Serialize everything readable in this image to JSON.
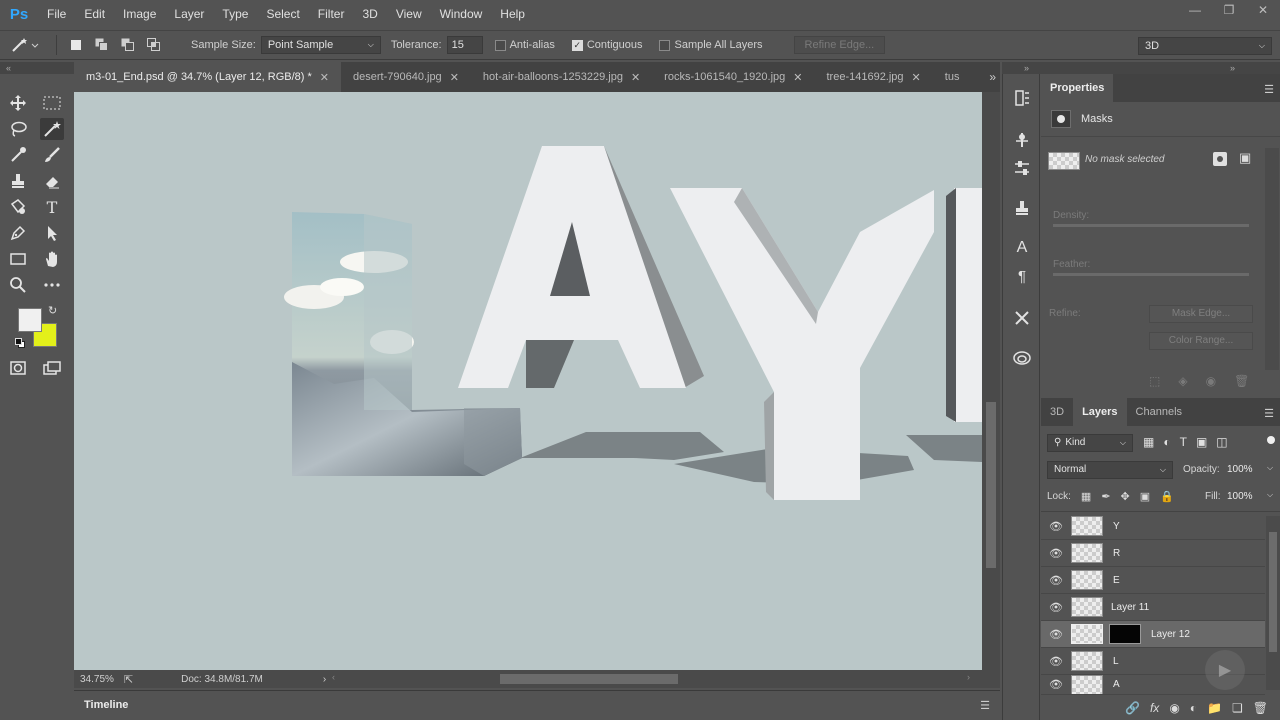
{
  "app": {
    "logo": "Ps"
  },
  "menu": [
    "File",
    "Edit",
    "Image",
    "Layer",
    "Type",
    "Select",
    "Filter",
    "3D",
    "View",
    "Window",
    "Help"
  ],
  "window_controls": [
    "—",
    "❐",
    "✕"
  ],
  "options": {
    "sample_size_label": "Sample Size:",
    "sample_size_value": "Point Sample",
    "tolerance_label": "Tolerance:",
    "tolerance_value": "15",
    "anti_alias_label": "Anti-alias",
    "anti_alias_checked": false,
    "contiguous_label": "Contiguous",
    "contiguous_checked": true,
    "sample_all_label": "Sample All Layers",
    "sample_all_checked": false,
    "refine_edge_label": "Refine Edge...",
    "workspace_value": "3D"
  },
  "tabs": [
    {
      "label": "m3-01_End.psd @ 34.7% (Layer 12, RGB/8) *",
      "active": true
    },
    {
      "label": "desert-790640.jpg",
      "active": false
    },
    {
      "label": "hot-air-balloons-1253229.jpg",
      "active": false
    },
    {
      "label": "rocks-1061540_1920.jpg",
      "active": false
    },
    {
      "label": "tree-141692.jpg",
      "active": false
    },
    {
      "label": "tus",
      "active": false
    }
  ],
  "tabs_overflow": "»",
  "status": {
    "zoom": "34.75%",
    "doc": "Doc: 34.8M/81.7M"
  },
  "timeline": {
    "label": "Timeline"
  },
  "canvas": {
    "letters": [
      "L",
      "A",
      "Y"
    ],
    "background": "#bac7c8"
  },
  "tool_icons": [
    "move-icon",
    "marquee-icon",
    "lasso-icon",
    "magic-wand-icon",
    "eyedropper-icon",
    "brush-icon",
    "stamp-icon",
    "eraser-icon",
    "history-brush-icon",
    "type-icon",
    "pen-icon",
    "path-select-icon",
    "rectangle-icon",
    "hand-icon",
    "zoom-icon",
    "more-tools-icon"
  ],
  "colors": {
    "foreground": "#f0f0f0",
    "background": "#e3f01a"
  },
  "properties": {
    "title": "Properties",
    "section": "Masks",
    "no_mask": "No mask selected",
    "density_label": "Density:",
    "feather_label": "Feather:",
    "refine_label": "Refine:",
    "mask_edge_btn": "Mask Edge...",
    "color_range_btn": "Color Range..."
  },
  "layers_panel": {
    "tabs": [
      "3D",
      "Layers",
      "Channels"
    ],
    "active_tab": "Layers",
    "kind_label": "Kind",
    "blend_mode": "Normal",
    "opacity_label": "Opacity:",
    "opacity_value": "100%",
    "lock_label": "Lock:",
    "fill_label": "Fill:",
    "fill_value": "100%",
    "layers": [
      {
        "name": "Y",
        "selected": false,
        "mask": false
      },
      {
        "name": "R",
        "selected": false,
        "mask": false
      },
      {
        "name": "E",
        "selected": false,
        "mask": false
      },
      {
        "name": "Layer 11",
        "selected": false,
        "mask": false
      },
      {
        "name": "Layer 12",
        "selected": true,
        "mask": true
      },
      {
        "name": "L",
        "selected": false,
        "mask": false
      },
      {
        "name": "A",
        "selected": false,
        "mask": false
      }
    ]
  }
}
